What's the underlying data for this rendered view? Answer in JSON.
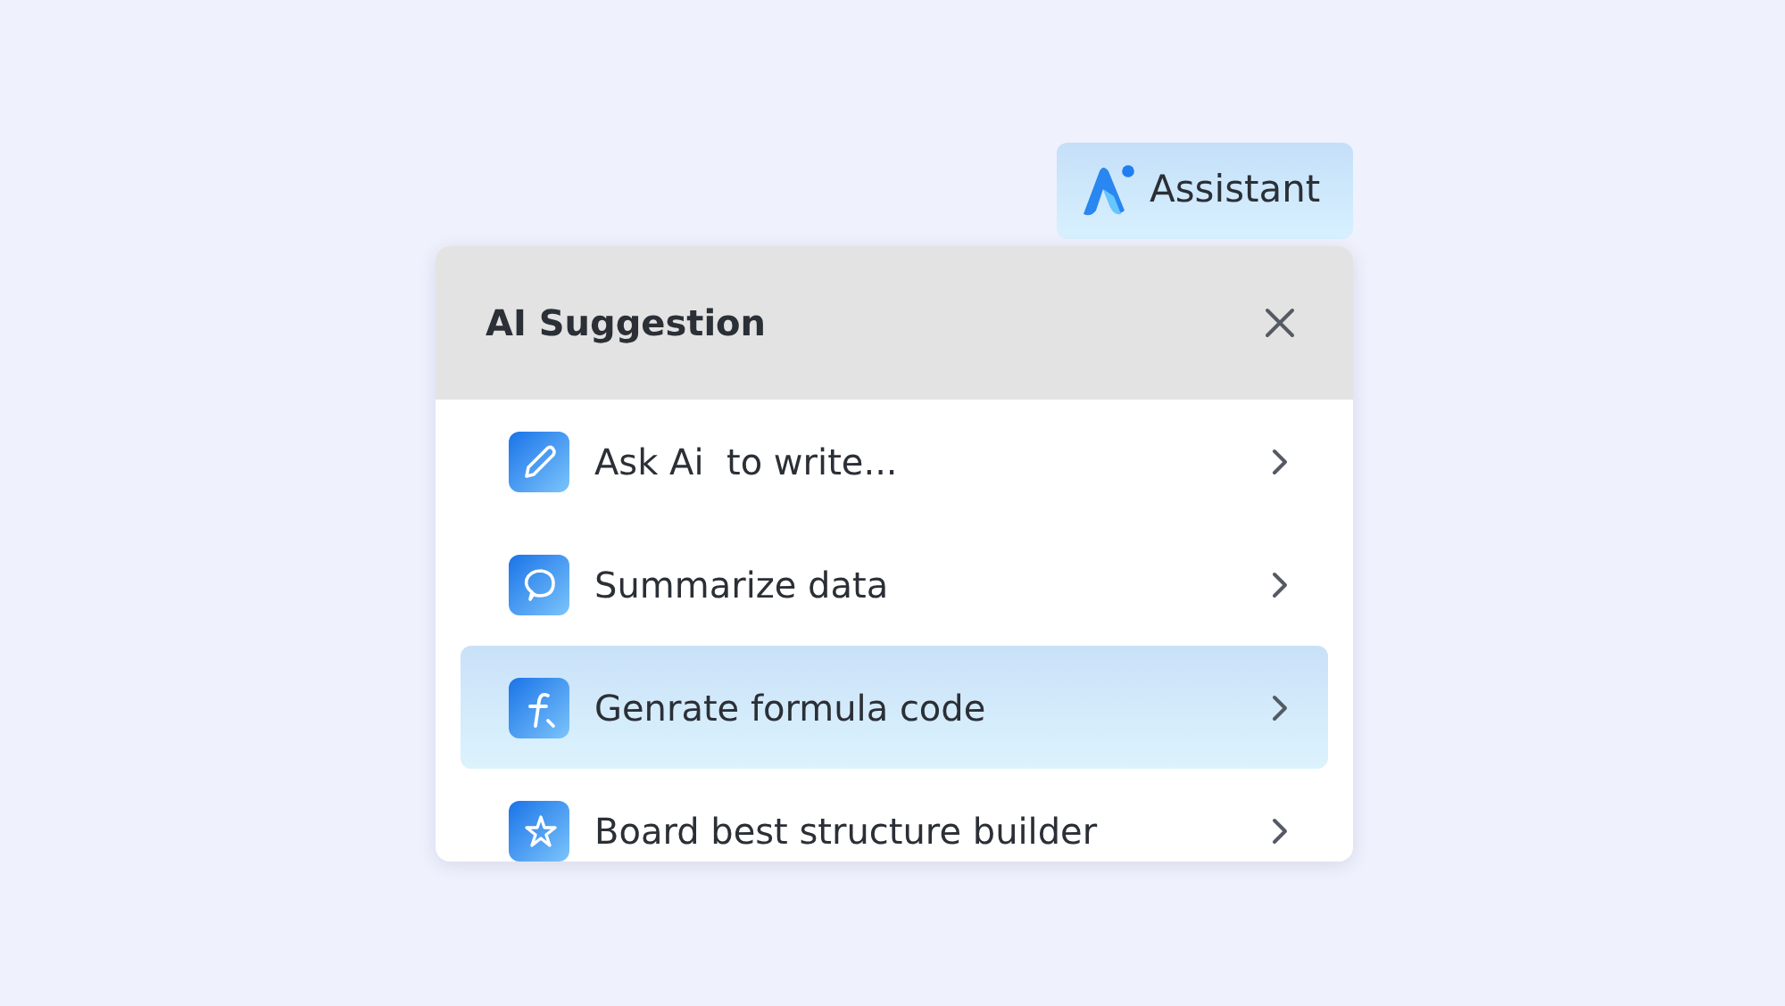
{
  "assistant_button": {
    "label": "Assistant"
  },
  "panel": {
    "title": "AI Suggestion",
    "items": [
      {
        "kind": "pencil",
        "label": "Ask Ai  to write...",
        "selected": false
      },
      {
        "kind": "chat",
        "label": "Summarize data",
        "selected": false
      },
      {
        "kind": "formula",
        "label": "Genrate formula code",
        "selected": true
      },
      {
        "kind": "sparkle",
        "label": "Board best structure builder",
        "selected": false
      }
    ]
  }
}
